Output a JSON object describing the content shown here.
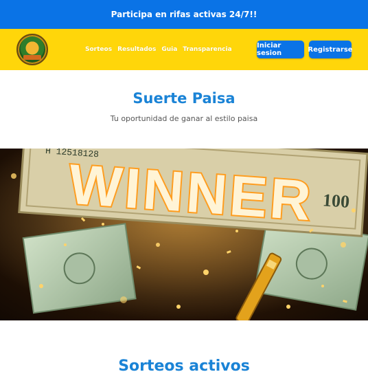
{
  "promo": {
    "text": "Participa en rifas activas 24/7!!"
  },
  "header": {
    "nav": [
      "Sorteos",
      "Resultados",
      "Guia",
      "Transparencia"
    ],
    "login_label": "Iniciar sesion",
    "register_label": "Registrarse"
  },
  "hero": {
    "title": "Suerte Paisa",
    "subtitle": "Tu oportunidad de ganar al estilo paisa"
  },
  "banner": {
    "headline": "WINNER",
    "bill_serial": "H 12518128",
    "bill_denomination": "100"
  },
  "section": {
    "title": "Sorteos activos"
  },
  "colors": {
    "primary_blue": "#0a73e6",
    "accent_yellow": "#ffd60a",
    "title_blue": "#1a83d6"
  }
}
